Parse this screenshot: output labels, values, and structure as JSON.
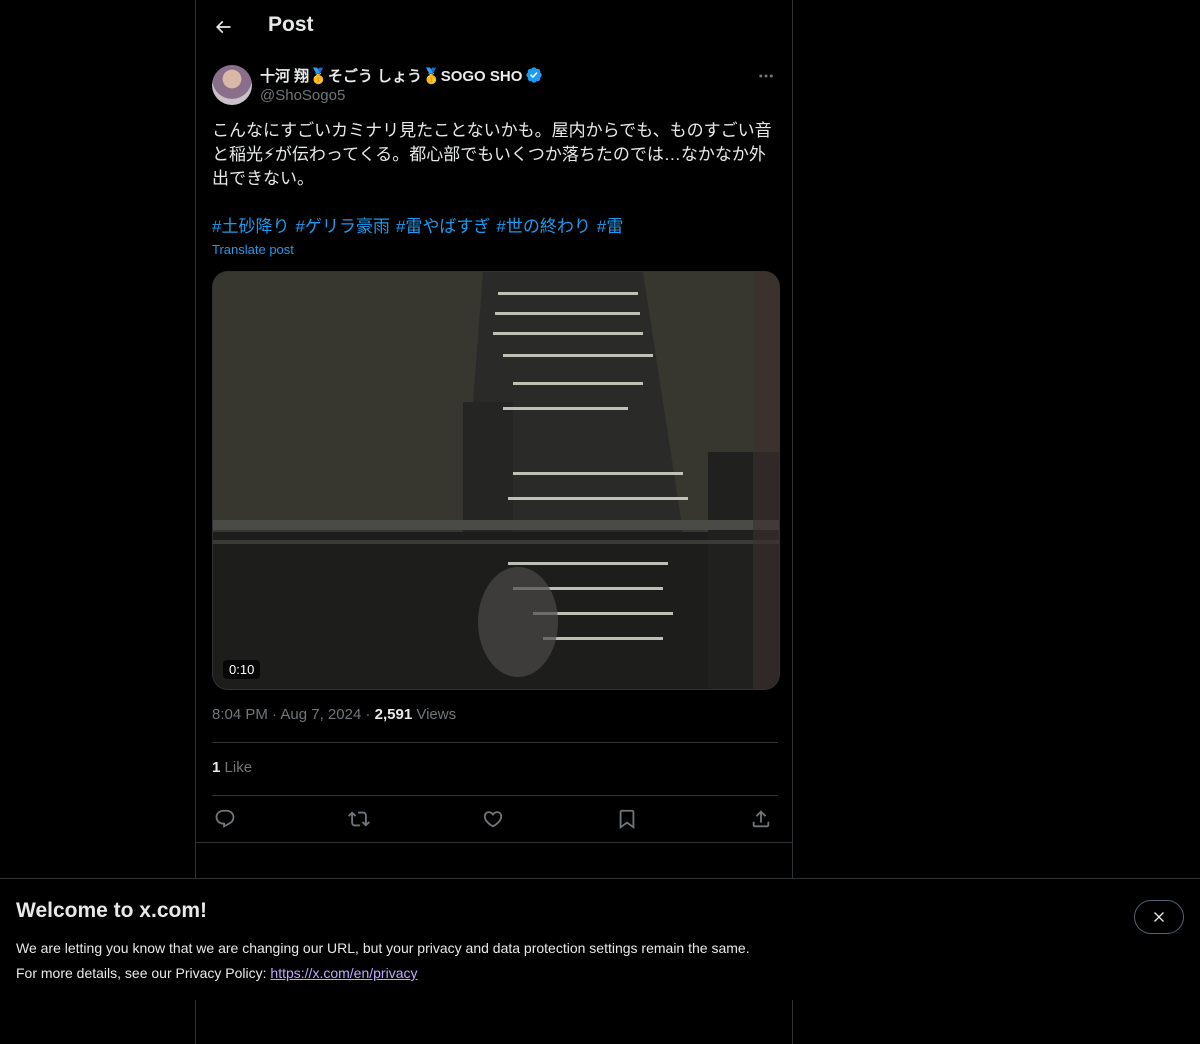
{
  "header": {
    "title": "Post"
  },
  "author": {
    "display_name": "十河 翔🥇そごう しょう🥇SOGO SHO",
    "handle": "@ShoSogo5",
    "verified": true
  },
  "post": {
    "text": "こんなにすごいカミナリ見たことないかも。屋内からでも、ものすごい音と稲光⚡が伝わってくる。都心部でもいくつか落ちたのでは…なかなか外出できない。",
    "hashtags": [
      "#土砂降り",
      "#ゲリラ豪雨",
      "#雷やばすぎ",
      "#世の終わり",
      "#雷"
    ],
    "translate_label": "Translate post",
    "video_duration": "0:10",
    "time": "8:04 PM",
    "date": "Aug 7, 2024",
    "separator": "·",
    "views_count": "2,591",
    "views_label": "Views",
    "likes_count": "1",
    "likes_label": "Like"
  },
  "actions": {
    "reply_icon": "reply-icon",
    "repost_icon": "repost-icon",
    "like_icon": "heart-icon",
    "bookmark_icon": "bookmark-icon",
    "share_icon": "share-icon"
  },
  "banner": {
    "title": "Welcome to x.com!",
    "line1": "We are letting you know that we are changing our URL, but your privacy and data protection settings remain the same.",
    "line2_prefix": "For more details, see our Privacy Policy: ",
    "link": "https://x.com/en/privacy"
  },
  "colors": {
    "background": "#000000",
    "text": "#e7e9ea",
    "muted": "#71767b",
    "accent": "#1d9bf0",
    "border": "#2f3336",
    "link_visited": "#c1a7ff"
  }
}
